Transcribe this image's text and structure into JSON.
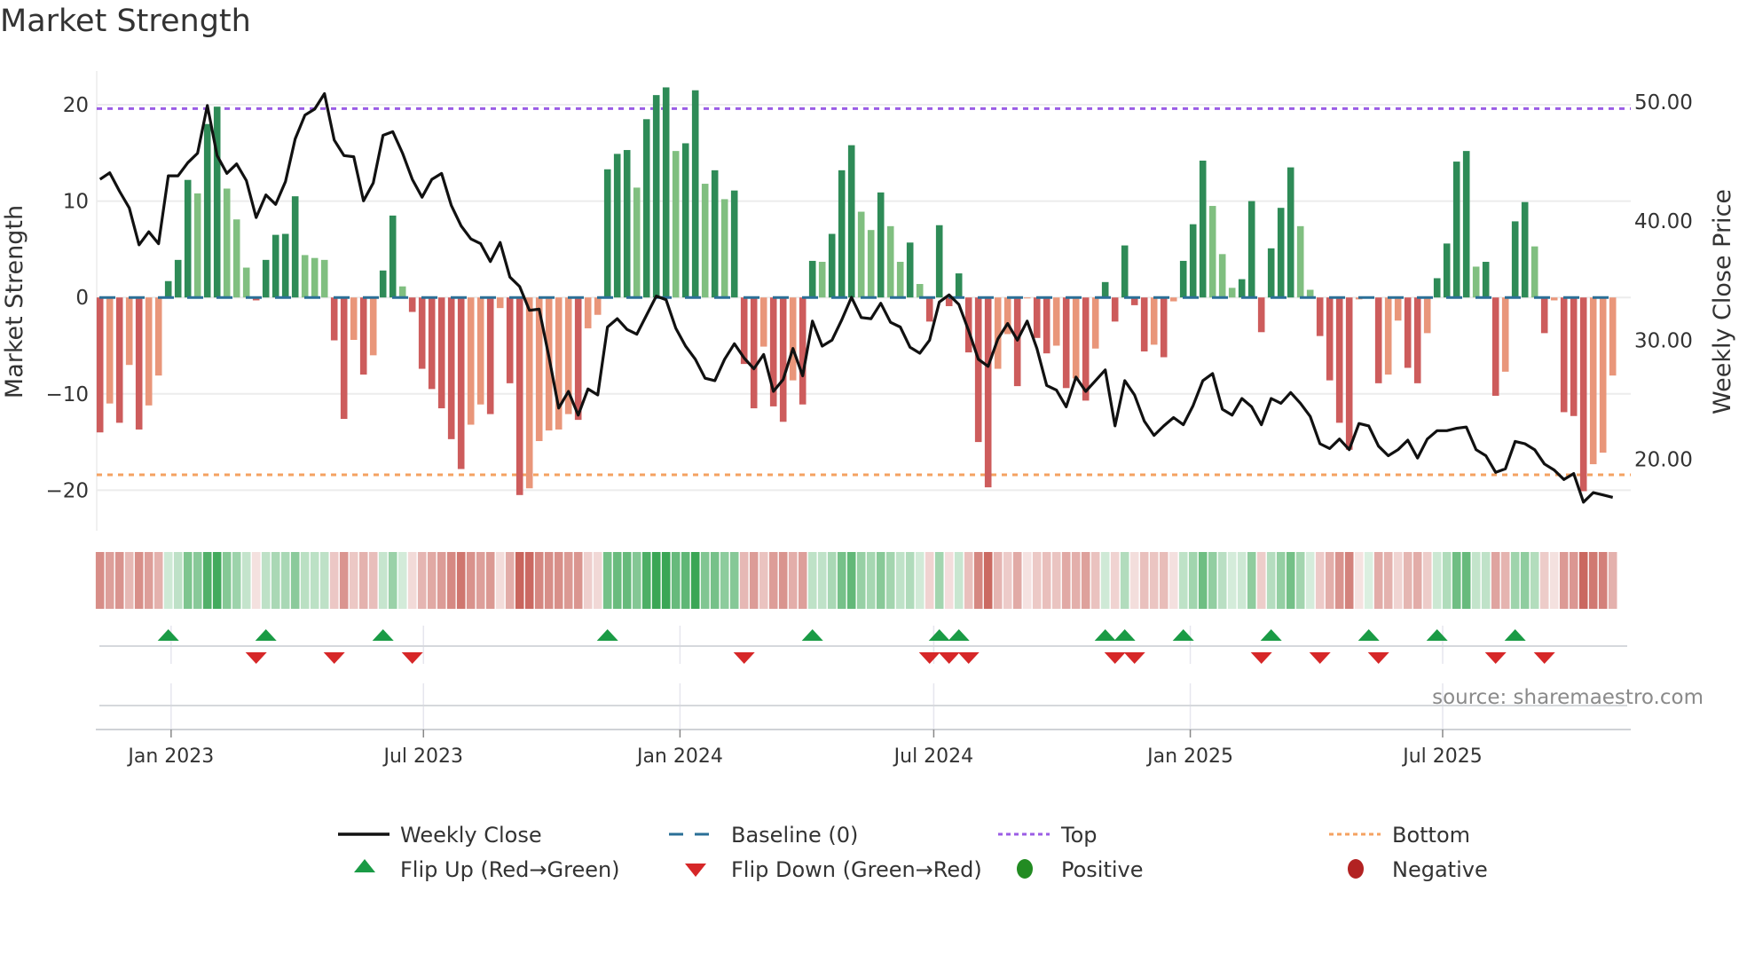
{
  "title": "Market Strength",
  "source": "source: sharemaestro.com",
  "chart_data": {
    "type": "bar",
    "title": "Market Strength",
    "ylabel": "Market Strength",
    "y2label": "Weekly Close Price",
    "ylim": [
      -24.2,
      23.5
    ],
    "y2lim": [
      14.0,
      52.6
    ],
    "start_date": "2022-11-11",
    "frequency": "weekly",
    "top_threshold": 19.6,
    "bottom_threshold": -18.4,
    "baseline": 0,
    "yticks": [
      {
        "v": 20,
        "label": "20"
      },
      {
        "v": 10,
        "label": "10"
      },
      {
        "v": 0,
        "label": "0"
      },
      {
        "v": -10,
        "label": "−10"
      },
      {
        "v": -20,
        "label": "−20"
      }
    ],
    "y2ticks": [
      {
        "v": 50,
        "label": "50.00"
      },
      {
        "v": 40,
        "label": "40.00"
      },
      {
        "v": 30,
        "label": "30.00"
      },
      {
        "v": 20,
        "label": "20.00"
      }
    ],
    "xticks": [
      {
        "date": "2023-01-01",
        "label": "Jan 2023"
      },
      {
        "date": "2023-07-01",
        "label": "Jul 2023"
      },
      {
        "date": "2024-01-01",
        "label": "Jan 2024"
      },
      {
        "date": "2024-07-01",
        "label": "Jul 2024"
      },
      {
        "date": "2025-01-01",
        "label": "Jan 2025"
      },
      {
        "date": "2025-07-01",
        "label": "Jul 2025"
      }
    ],
    "strength": [
      -14,
      -11,
      -13,
      -7,
      -13.7,
      -11.2,
      -8.1,
      1.7,
      3.9,
      12.2,
      10.8,
      18,
      19.8,
      11.3,
      8.1,
      3.1,
      -0.3,
      3.9,
      6.5,
      6.6,
      10.5,
      4.4,
      4.1,
      3.9,
      -4.45,
      -12.6,
      -4.4,
      -8.0,
      -6.0,
      2.8,
      8.5,
      1.15,
      -1.5,
      -7.4,
      -9.5,
      -11.5,
      -14.7,
      -17.8,
      -13.2,
      -11.1,
      -12.1,
      -1.1,
      -8.9,
      -20.5,
      -19.8,
      -14.9,
      -13.8,
      -13.7,
      -12.1,
      -12.7,
      -3.2,
      -1.8,
      13.3,
      14.9,
      15.3,
      11.4,
      18.5,
      21.0,
      21.8,
      15.2,
      16.0,
      21.5,
      11.8,
      13.2,
      10.2,
      11.1,
      -6.9,
      -11.5,
      -5.1,
      -11.3,
      -12.9,
      -8.6,
      -11.1,
      3.8,
      3.7,
      6.6,
      13.2,
      15.8,
      8.9,
      7.0,
      10.9,
      7.4,
      3.7,
      5.7,
      1.4,
      -2.5,
      7.5,
      -0.9,
      2.5,
      -5.7,
      -15.0,
      -19.7,
      -7.4,
      -3.8,
      -9.2,
      -0.1,
      -4.2,
      -5.8,
      -5.0,
      -9.4,
      -8.4,
      -10.7,
      -5.3,
      1.6,
      -2.5,
      5.4,
      -0.8,
      -5.6,
      -4.9,
      -6.2,
      -0.4,
      3.8,
      7.6,
      14.2,
      9.5,
      4.5,
      1.0,
      1.9,
      10.0,
      -3.6,
      5.1,
      9.3,
      13.5,
      7.4,
      0.8,
      -4.0,
      -8.6,
      -13.0,
      -15.8,
      -0.2,
      0.1,
      -8.9,
      -8.0,
      -2.4,
      -7.3,
      -8.9,
      -3.7,
      2.0,
      5.6,
      14.1,
      15.2,
      3.2,
      3.7,
      -10.2,
      -7.7,
      7.9,
      9.9,
      5.3,
      -3.7,
      -0.3,
      -11.9,
      -12.3,
      -20.1,
      -17.3,
      -16.1,
      -8.1
    ],
    "close": [
      43.5,
      44.05,
      42.5,
      41.1,
      38.0,
      39.1,
      38.1,
      43.8,
      43.8,
      44.9,
      45.7,
      49.7,
      45.5,
      44.0,
      44.8,
      43.4,
      40.3,
      42.2,
      41.4,
      43.3,
      46.9,
      48.9,
      49.4,
      50.7,
      46.8,
      45.5,
      45.4,
      41.7,
      43.2,
      47.2,
      47.5,
      45.7,
      43.5,
      42.0,
      43.5,
      44.0,
      41.3,
      39.6,
      38.5,
      38.1,
      36.6,
      38.2,
      35.3,
      34.5,
      32.5,
      32.6,
      28.6,
      24.3,
      25.7,
      23.7,
      25.9,
      25.4,
      31.1,
      31.8,
      30.9,
      30.5,
      32.1,
      33.7,
      33.4,
      31.0,
      29.5,
      28.4,
      26.8,
      26.6,
      28.4,
      29.7,
      28.5,
      27.6,
      28.8,
      25.7,
      26.7,
      29.3,
      27.0,
      31.6,
      29.5,
      30.0,
      31.7,
      33.6,
      31.9,
      31.8,
      33.1,
      31.5,
      31.1,
      29.4,
      28.9,
      30.0,
      33.2,
      33.8,
      33.0,
      30.8,
      28.4,
      27.8,
      30.1,
      31.4,
      30.0,
      31.6,
      29.3,
      26.2,
      25.8,
      24.4,
      26.9,
      25.7,
      26.6,
      27.5,
      22.8,
      26.6,
      25.4,
      23.2,
      22.0,
      22.8,
      23.5,
      22.9,
      24.5,
      26.6,
      27.2,
      24.2,
      23.7,
      25.1,
      24.4,
      22.9,
      25.1,
      24.7,
      25.6,
      24.7,
      23.6,
      21.3,
      20.9,
      21.7,
      20.8,
      23.0,
      22.8,
      21.1,
      20.3,
      20.8,
      21.6,
      20.1,
      21.7,
      22.4,
      22.4,
      22.6,
      22.7,
      20.8,
      20.3,
      18.9,
      19.2,
      21.5,
      21.3,
      20.8,
      19.6,
      19.1,
      18.3,
      18.8,
      16.4,
      17.2,
      17.0,
      16.8
    ],
    "legend": {
      "placement": "bottom",
      "items": [
        {
          "key": "close",
          "label": "Weekly Close"
        },
        {
          "key": "baseline",
          "label": "Baseline (0)"
        },
        {
          "key": "top",
          "label": "Top"
        },
        {
          "key": "bottom",
          "label": "Bottom"
        },
        {
          "key": "flip_up",
          "label": "Flip Up (Red→Green)"
        },
        {
          "key": "flip_down",
          "label": "Flip Down (Green→Red)"
        },
        {
          "key": "positive",
          "label": "Positive"
        },
        {
          "key": "negative",
          "label": "Negative"
        }
      ]
    },
    "colors": {
      "pos_strong": "#2e8b57",
      "pos_weak": "#80bf80",
      "neg_strong": "#cd5c5c",
      "neg_weak": "#e9967a",
      "close": "#111111",
      "baseline": "#2a6f97",
      "top": "#9b5de5",
      "bottom": "#f4a261",
      "flip_up": "#1a9b45",
      "flip_down": "#d62728",
      "positive": "#228b22",
      "negative": "#b22222",
      "heat_pos": "#3aa655",
      "heat_neg": "#c8625a"
    }
  }
}
